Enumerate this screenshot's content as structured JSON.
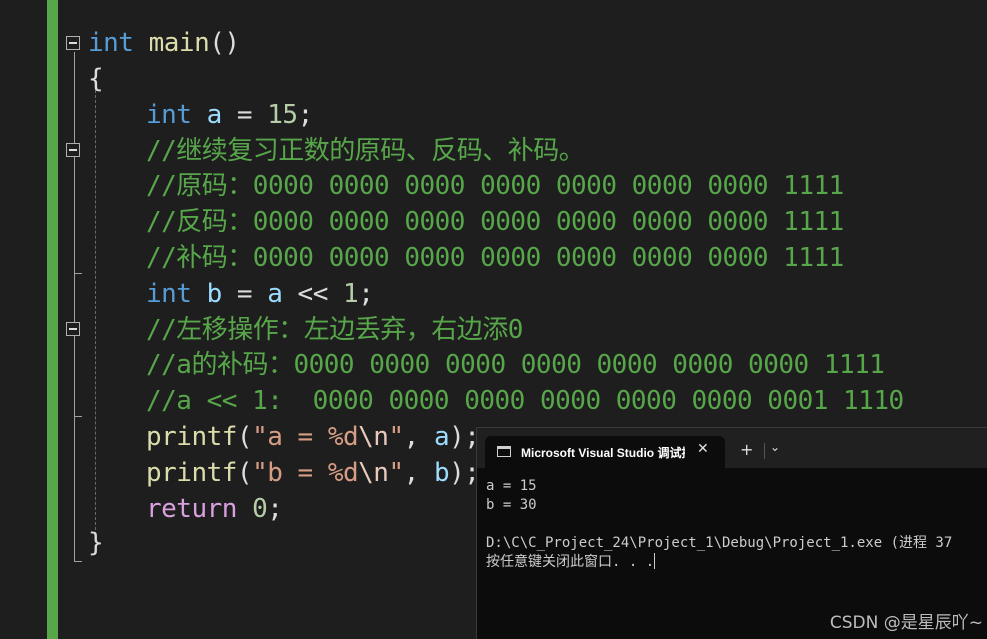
{
  "editor": {
    "line1": {
      "kw": "int",
      "fn": "main",
      "punc": "()"
    },
    "line2": {
      "brace": "{"
    },
    "line3": {
      "kw": "int",
      "var": "a",
      "op": " = ",
      "num": "15",
      "end": ";"
    },
    "line4": {
      "comment": "//继续复习正数的原码、反码、补码。"
    },
    "line5": {
      "comment": "//原码：0000 0000 0000 0000 0000 0000 0000 1111"
    },
    "line6": {
      "comment": "//反码：0000 0000 0000 0000 0000 0000 0000 1111"
    },
    "line7": {
      "comment": "//补码：0000 0000 0000 0000 0000 0000 0000 1111"
    },
    "line8": {
      "kw": "int",
      "var": "b",
      "op": " = ",
      "var2": "a",
      "op2": " << ",
      "num": "1",
      "end": ";"
    },
    "line9": {
      "comment": "//左移操作：左边丢弃，右边添0"
    },
    "line10": {
      "comment": "//a的补码：0000 0000 0000 0000 0000 0000 0000 1111"
    },
    "line11": {
      "comment": "//a << 1:  0000 0000 0000 0000 0000 0000 0001 1110"
    },
    "line12": {
      "fn": "printf",
      "open": "(",
      "str1": "\"a = %d",
      "esc": "\\n",
      "str2": "\"",
      "sep": ", ",
      "var": "a",
      "close": ");"
    },
    "line13": {
      "fn": "printf",
      "open": "(",
      "str1": "\"b = %d",
      "esc": "\\n",
      "str2": "\"",
      "sep": ", ",
      "var": "b",
      "close": ");"
    },
    "line14": {
      "kw": "return",
      "num": "0",
      "end": ";"
    },
    "line15": {
      "brace": "}"
    }
  },
  "console": {
    "tab_title": "Microsoft Visual Studio 调试控",
    "close_glyph": "✕",
    "plus_glyph": "+",
    "dropdown_glyph": "⌄",
    "output": [
      "a = 15",
      "b = 30",
      "",
      "D:\\C\\C_Project_24\\Project_1\\Debug\\Project_1.exe (进程 37",
      "按任意键关闭此窗口. . ."
    ]
  },
  "watermark": "CSDN @是星辰吖~",
  "colors": {
    "background": "#1e1e1e",
    "keyword": "#569cd6",
    "function": "#dcdcaa",
    "variable": "#9cdcfe",
    "number": "#b5cea8",
    "string": "#d69d85",
    "comment": "#57a64a",
    "control_keyword": "#d8a0df",
    "change_margin": "#57a64a"
  },
  "icons": {
    "fold": "collapse-icon",
    "console_tab": "terminal-icon"
  }
}
